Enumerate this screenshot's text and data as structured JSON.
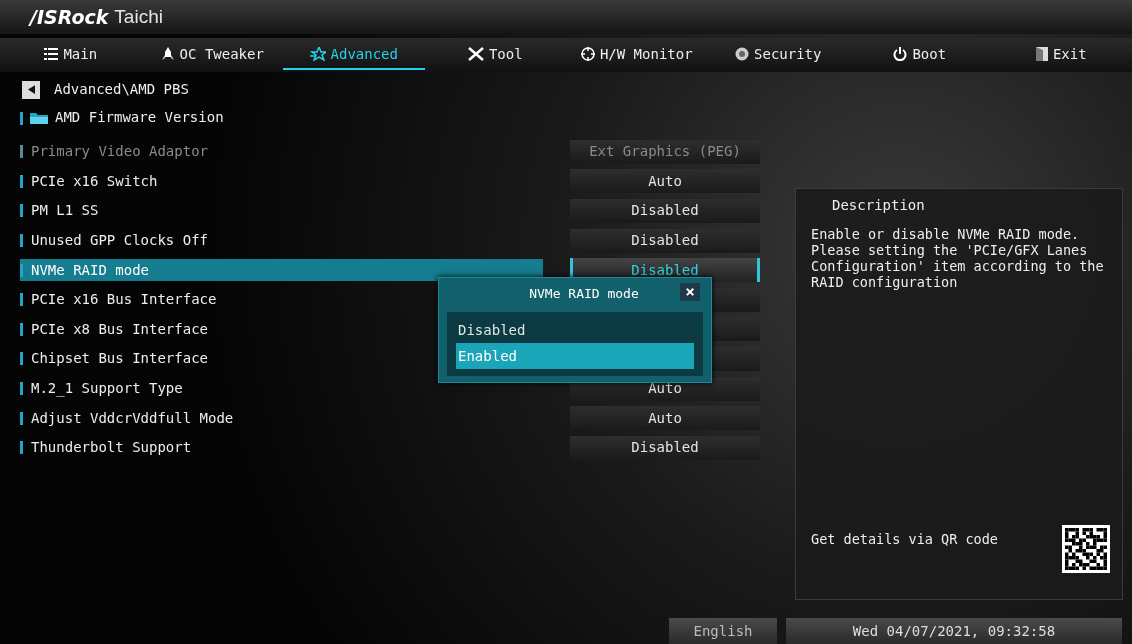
{
  "brand": {
    "logo": "/ISRock",
    "model": "Taichi"
  },
  "tabs": [
    {
      "label": "Main",
      "selected": false
    },
    {
      "label": "OC Tweaker",
      "selected": false
    },
    {
      "label": "Advanced",
      "selected": true
    },
    {
      "label": "Tool",
      "selected": false
    },
    {
      "label": "H/W Monitor",
      "selected": false
    },
    {
      "label": "Security",
      "selected": false
    },
    {
      "label": "Boot",
      "selected": false
    },
    {
      "label": "Exit",
      "selected": false
    }
  ],
  "breadcrumb": "Advanced\\AMD PBS",
  "folder": "AMD Firmware Version",
  "settings": [
    {
      "label": "Primary Video Adaptor",
      "value": "Ext Graphics (PEG)",
      "disabled": true,
      "selected": false
    },
    {
      "label": "PCIe x16 Switch",
      "value": "Auto",
      "disabled": false,
      "selected": false
    },
    {
      "label": "PM L1 SS",
      "value": "Disabled",
      "disabled": false,
      "selected": false
    },
    {
      "label": "Unused GPP Clocks Off",
      "value": "Disabled",
      "disabled": false,
      "selected": false
    },
    {
      "label": "NVMe RAID mode",
      "value": "Disabled",
      "disabled": false,
      "selected": true
    },
    {
      "label": "PCIe x16 Bus Interface",
      "disabled": false,
      "selected": false
    },
    {
      "label": "PCIe x8 Bus Interface",
      "disabled": false,
      "selected": false
    },
    {
      "label": "Chipset Bus Interface",
      "disabled": false,
      "selected": false
    },
    {
      "label": "M.2_1 Support Type",
      "value": "Auto",
      "disabled": false,
      "selected": false
    },
    {
      "label": "Adjust VddcrVddfull Mode",
      "value": "Auto",
      "disabled": false,
      "selected": false
    },
    {
      "label": "Thunderbolt Support",
      "value": "Disabled",
      "disabled": false,
      "selected": false
    }
  ],
  "popup": {
    "title": "NVMe RAID mode",
    "close": "×",
    "options": [
      {
        "label": "Disabled",
        "selected": false
      },
      {
        "label": "Enabled",
        "selected": true
      }
    ]
  },
  "description": {
    "title": "Description",
    "text": "Enable or disable NVMe RAID mode. Please setting the 'PCIe/GFX Lanes Configuration' item according to the RAID configuration",
    "qr_hint": "Get details via QR code"
  },
  "status_bar": {
    "language": "English",
    "datetime": "Wed 04/07/2021, 09:32:58"
  }
}
